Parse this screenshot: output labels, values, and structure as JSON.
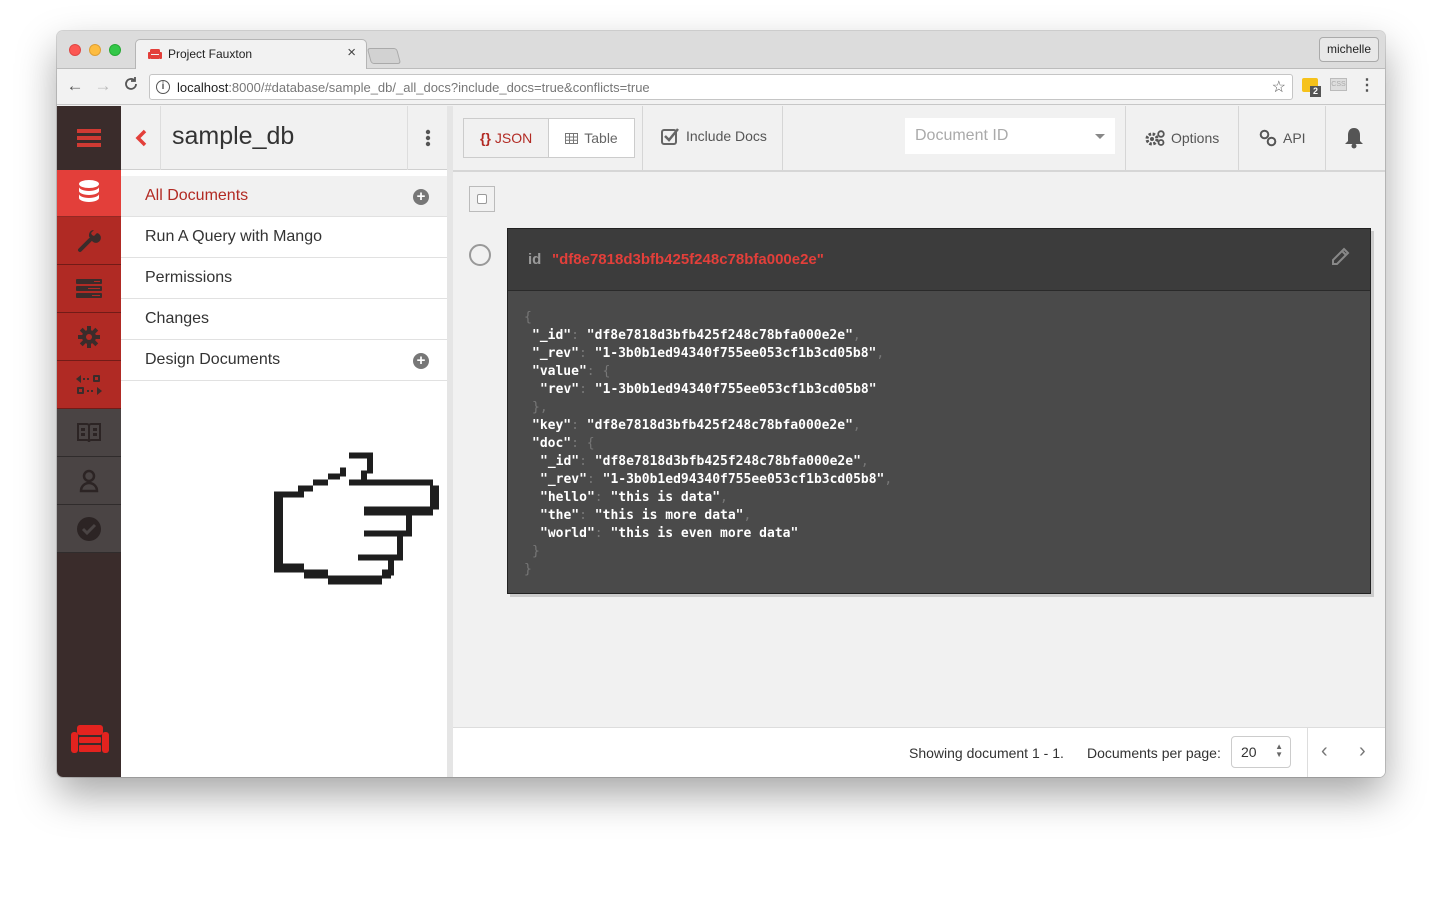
{
  "browser": {
    "tab_title": "Project Fauxton",
    "tab_close": "×",
    "profile_name": "michelle",
    "url_host": "localhost",
    "url_rest": ":8000/#database/sample_db/_all_docs?include_docs=true&conflicts=true",
    "nav_back": "←",
    "nav_forward": "→",
    "nav_reload": "C",
    "info_icon": "i",
    "star_icon": "☆",
    "ext_badge": "2",
    "ext2_label": "CSS",
    "menu_icon": "⋮"
  },
  "primary_nav": {
    "items": [
      {
        "name": "databases",
        "icon": "database-icon",
        "active": true
      },
      {
        "name": "setup",
        "icon": "wrench-icon"
      },
      {
        "name": "active-tasks",
        "icon": "server-list-icon"
      },
      {
        "name": "config",
        "icon": "gear-icon"
      },
      {
        "name": "replication",
        "icon": "replication-icon"
      },
      {
        "name": "documentation",
        "icon": "book-icon"
      },
      {
        "name": "user",
        "icon": "user-icon"
      },
      {
        "name": "verify",
        "icon": "check-circle-icon"
      }
    ]
  },
  "sidebar": {
    "title": "sample_db",
    "items": [
      {
        "label": "All Documents",
        "active": true,
        "has_add": true
      },
      {
        "label": "Run A Query with Mango"
      },
      {
        "label": "Permissions"
      },
      {
        "label": "Changes"
      },
      {
        "label": "Design Documents",
        "has_add": true
      }
    ]
  },
  "header": {
    "json_label": "JSON",
    "json_icon": "{}",
    "table_label": "Table",
    "include_docs_label": "Include Docs",
    "include_docs_checked": true,
    "doc_id_placeholder": "Document ID",
    "options_label": "Options",
    "api_label": "API"
  },
  "document": {
    "id_label": "id",
    "id_value": "\"df8e7818d3bfb425f248c78bfa000e2e\"",
    "json_lines": [
      {
        "indent": 0,
        "text": "{",
        "punct": true
      },
      {
        "indent": 1,
        "key": "\"_id\"",
        "value": "\"df8e7818d3bfb425f248c78bfa000e2e\"",
        "trail": ","
      },
      {
        "indent": 1,
        "key": "\"_rev\"",
        "value": "\"1-3b0b1ed94340f755ee053cf1b3cd05b8\"",
        "trail": ","
      },
      {
        "indent": 1,
        "key": "\"value\"",
        "value": "",
        "trail": "{"
      },
      {
        "indent": 2,
        "key": "\"rev\"",
        "value": "\"1-3b0b1ed94340f755ee053cf1b3cd05b8\"",
        "trail": ""
      },
      {
        "indent": 1,
        "text": "},",
        "punct": true
      },
      {
        "indent": 1,
        "key": "\"key\"",
        "value": "\"df8e7818d3bfb425f248c78bfa000e2e\"",
        "trail": ","
      },
      {
        "indent": 1,
        "key": "\"doc\"",
        "value": "",
        "trail": "{"
      },
      {
        "indent": 2,
        "key": "\"_id\"",
        "value": "\"df8e7818d3bfb425f248c78bfa000e2e\"",
        "trail": ","
      },
      {
        "indent": 2,
        "key": "\"_rev\"",
        "value": "\"1-3b0b1ed94340f755ee053cf1b3cd05b8\"",
        "trail": ","
      },
      {
        "indent": 2,
        "key": "\"hello\"",
        "value": "\"this is data\"",
        "trail": ","
      },
      {
        "indent": 2,
        "key": "\"the\"",
        "value": "\"this is more data\"",
        "trail": ","
      },
      {
        "indent": 2,
        "key": "\"world\"",
        "value": "\"this is even more data\"",
        "trail": ""
      },
      {
        "indent": 1,
        "text": "}",
        "punct": true
      },
      {
        "indent": 0,
        "text": "}",
        "punct": true
      }
    ]
  },
  "footer": {
    "status": "Showing document 1 - 1.",
    "per_page_label": "Documents per page:",
    "per_page_value": "20",
    "prev": "‹",
    "next": "›"
  },
  "colors": {
    "accent_red": "#e33f3a",
    "dark_red": "#b02a24",
    "nav_dark": "#3a2c2b"
  }
}
